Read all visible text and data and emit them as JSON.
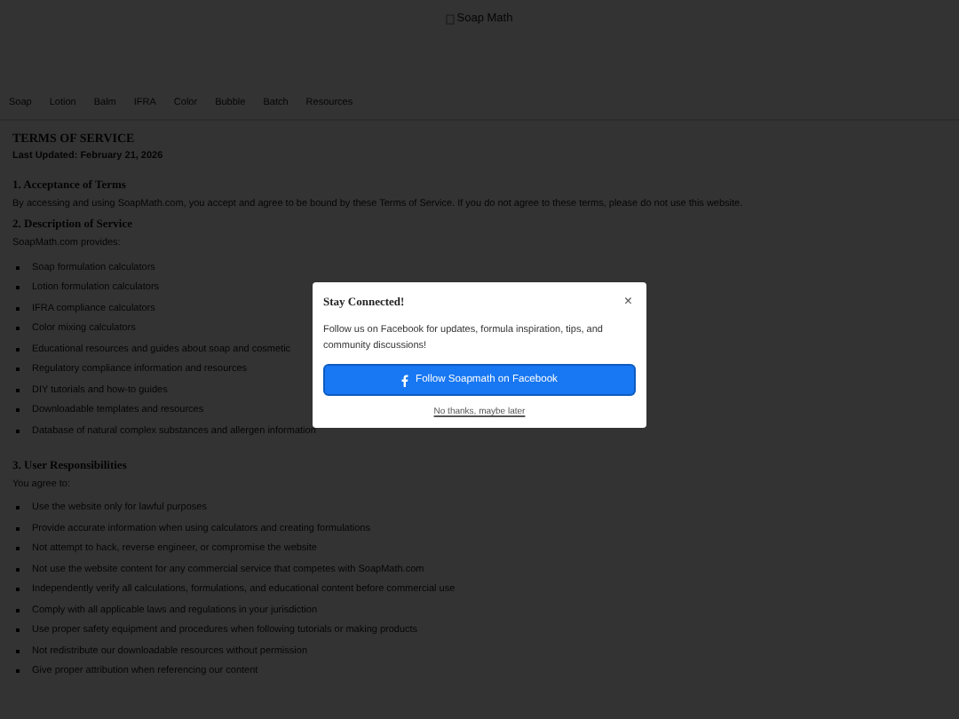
{
  "header": {
    "logo_alt": "Soap Math"
  },
  "nav": [
    "Soap",
    "Lotion",
    "Balm",
    "IFRA",
    "Color",
    "Bubble",
    "Batch",
    "Resources"
  ],
  "page": {
    "title": "TERMS OF SERVICE",
    "updated": "Last Updated: February 21, 2026",
    "sections": [
      {
        "heading": "1. Acceptance of Terms",
        "paragraph": "By accessing and using SoapMath.com, you accept and agree to be bound by these Terms of Service. If you do not agree to these terms, please do not use this website."
      },
      {
        "heading": "2. Description of Service",
        "paragraph": "SoapMath.com provides:",
        "items": [
          "Soap formulation calculators",
          "Lotion formulation calculators",
          "IFRA compliance calculators",
          "Color mixing calculators",
          "Educational resources and guides about soap and cosmetic",
          "Regulatory compliance information and resources",
          "DIY tutorials and how-to guides",
          "Downloadable templates and resources",
          "Database of natural complex substances and allergen information"
        ]
      },
      {
        "heading": "3. User Responsibilities",
        "paragraph": "You agree to:",
        "items": [
          "Use the website only for lawful purposes",
          "Provide accurate information when using calculators and creating formulations",
          "Not attempt to hack, reverse engineer, or compromise the website",
          "Not use the website content for any commercial service that competes with SoapMath.com",
          "Independently verify all calculations, formulations, and educational content before commercial use",
          "Comply with all applicable laws and regulations in your jurisdiction",
          "Use proper safety equipment and procedures when following tutorials or making products",
          "Not redistribute our downloadable resources without permission",
          "Give proper attribution when referencing our content"
        ]
      }
    ]
  },
  "modal": {
    "title": "Stay Connected!",
    "close": "×",
    "text": "Follow us on Facebook for updates, formula inspiration, tips, and community discussions!",
    "button": "Follow Soapmath on Facebook",
    "dismiss": "No thanks, maybe later"
  }
}
